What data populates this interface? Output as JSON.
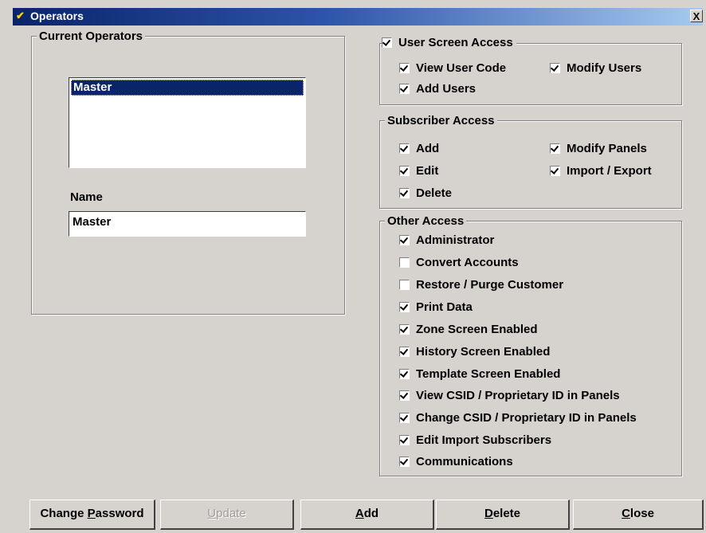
{
  "window": {
    "title": "Operators",
    "close_glyph": "X",
    "icon": "key-icon"
  },
  "current_operators": {
    "group_label": "Current Operators",
    "list": [
      "Master"
    ],
    "name_label": "Name",
    "name_value": "Master"
  },
  "user_screen_access": {
    "label": "User Screen Access",
    "checked": true,
    "items": [
      {
        "label": "View User Code",
        "checked": true
      },
      {
        "label": "Modify Users",
        "checked": true
      },
      {
        "label": "Add Users",
        "checked": true
      }
    ]
  },
  "subscriber_access": {
    "label": "Subscriber Access",
    "items": [
      {
        "label": "Add",
        "checked": true
      },
      {
        "label": "Modify Panels",
        "checked": true
      },
      {
        "label": "Edit",
        "checked": true
      },
      {
        "label": "Import / Export",
        "checked": true
      },
      {
        "label": "Delete",
        "checked": true
      }
    ]
  },
  "other_access": {
    "label": "Other Access",
    "items": [
      {
        "label": "Administrator",
        "checked": true
      },
      {
        "label": "Convert Accounts",
        "checked": false
      },
      {
        "label": "Restore / Purge Customer",
        "checked": false
      },
      {
        "label": "Print Data",
        "checked": true
      },
      {
        "label": "Zone Screen Enabled",
        "checked": true
      },
      {
        "label": "History Screen Enabled",
        "checked": true
      },
      {
        "label": "Template Screen Enabled",
        "checked": true
      },
      {
        "label": "View CSID / Proprietary ID in Panels",
        "checked": true
      },
      {
        "label": "Change CSID / Proprietary ID in Panels",
        "checked": true
      },
      {
        "label": "Edit Import Subscribers",
        "checked": true
      },
      {
        "label": "Communications",
        "checked": true
      }
    ]
  },
  "buttons": {
    "change_password": {
      "pre": "Change ",
      "ul": "P",
      "post": "assword",
      "enabled": true
    },
    "update": {
      "pre": "",
      "ul": "U",
      "post": "pdate",
      "enabled": false
    },
    "add": {
      "pre": "",
      "ul": "A",
      "post": "dd",
      "enabled": true
    },
    "delete": {
      "pre": "",
      "ul": "D",
      "post": "elete",
      "enabled": true
    },
    "close": {
      "pre": "",
      "ul": "C",
      "post": "lose",
      "enabled": true
    }
  },
  "colors": {
    "face": "#d6d3ce",
    "title_start": "#0a246a",
    "title_end": "#a6caf0",
    "selection": "#0a246a"
  }
}
